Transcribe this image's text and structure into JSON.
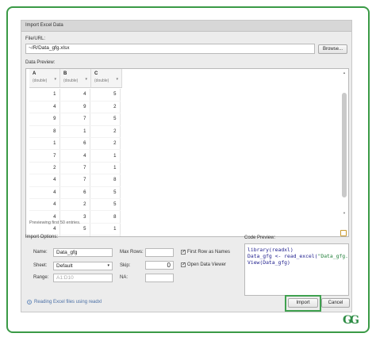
{
  "dialog": {
    "title": "Import Excel Data",
    "file_label": "File/URL:",
    "file_value": "~/R/Data_gfg.xlsx",
    "browse_label": "Browse...",
    "preview_label": "Data Preview:"
  },
  "preview": {
    "columns": [
      {
        "name": "A",
        "type": "(double)"
      },
      {
        "name": "B",
        "type": "(double)"
      },
      {
        "name": "C",
        "type": "(double)"
      }
    ],
    "rows": [
      [
        "1",
        "4",
        "5"
      ],
      [
        "4",
        "9",
        "2"
      ],
      [
        "9",
        "7",
        "5"
      ],
      [
        "8",
        "1",
        "2"
      ],
      [
        "1",
        "6",
        "2"
      ],
      [
        "7",
        "4",
        "1"
      ],
      [
        "2",
        "7",
        "1"
      ],
      [
        "4",
        "7",
        "8"
      ],
      [
        "4",
        "6",
        "5"
      ],
      [
        "4",
        "2",
        "5"
      ],
      [
        "4",
        "3",
        "8"
      ],
      [
        "4",
        "5",
        "1"
      ],
      [
        "5",
        "4",
        "6"
      ]
    ],
    "footer": "Previewing first 50 entries."
  },
  "options": {
    "section_label": "Import Options:",
    "name_label": "Name:",
    "name_value": "Data_gfg",
    "sheet_label": "Sheet:",
    "sheet_value": "Default",
    "range_label": "Range:",
    "range_placeholder": "A1:D10",
    "maxrows_label": "Max Rows:",
    "skip_label": "Skip:",
    "skip_value": "0",
    "na_label": "NA:",
    "first_row_label": "First Row as Names",
    "open_viewer_label": "Open Data Viewer",
    "first_row_checked": "✓",
    "open_viewer_checked": "✓"
  },
  "code": {
    "label": "Code Preview:",
    "line1": "library(readxl)",
    "line2a": "Data_gfg <- read_excel(",
    "line2b": "\"Data_gfg.xlsx\")",
    "line3": "View(Data_gfg)"
  },
  "footer": {
    "help_text": "Reading Excel files using readxl",
    "help_icon_glyph": "?",
    "import_label": "Import",
    "cancel_label": "Cancel"
  },
  "watermark": {
    "logo_text": "GG"
  },
  "colors": {
    "frame_border": "#3a9a46",
    "highlight": "#3fa14f",
    "code_text": "#1c1c8c",
    "code_string": "#1f7e37"
  },
  "icons": {
    "sort": "chevron-down-icon",
    "scroll_up": "arrow-up-icon",
    "scroll_down": "arrow-down-icon",
    "help": "help-circle-icon",
    "copy": "copy-icon"
  }
}
